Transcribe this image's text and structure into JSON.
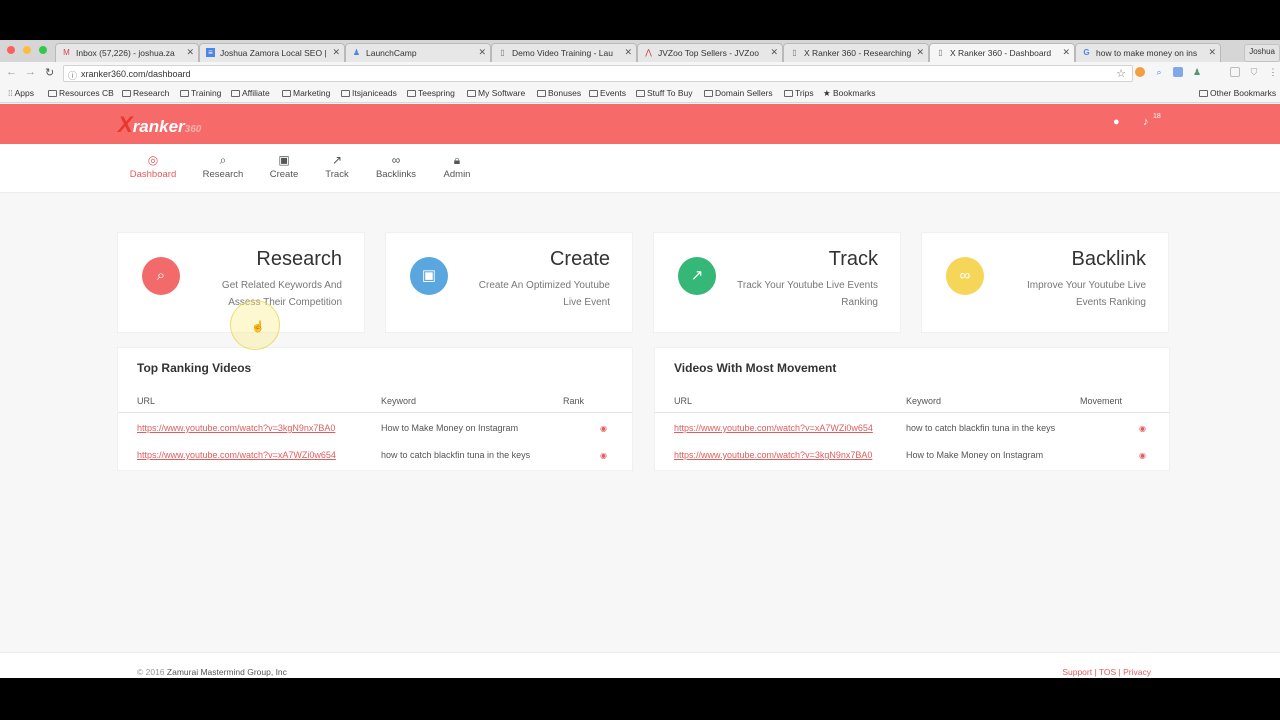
{
  "browser": {
    "tabs": [
      {
        "label": "Inbox (57,226) - joshua.za",
        "icon": "gmail-icon"
      },
      {
        "label": "Joshua Zamora Local SEO |",
        "icon": "doc-icon"
      },
      {
        "label": "LaunchCamp",
        "icon": "person-icon"
      },
      {
        "label": "Demo Video Training - Lau",
        "icon": "page-icon"
      },
      {
        "label": "JVZoo Top Sellers - JVZoo",
        "icon": "jvzoo-icon"
      },
      {
        "label": "X Ranker 360 - Researching",
        "icon": "page-icon"
      },
      {
        "label": "X Ranker 360 - Dashboard",
        "icon": "page-icon"
      },
      {
        "label": "how to make money on ins",
        "icon": "google-icon"
      }
    ],
    "profile": "Joshua",
    "url": "xranker360.com/dashboard",
    "bookmarks": [
      "Apps",
      "Resources CB",
      "Research",
      "Training",
      "Affiliate",
      "Marketing",
      "Itsjaniceads",
      "Teespring",
      "My Software",
      "Bonuses",
      "Events",
      "Stuff To Buy",
      "Domain Sellers",
      "Trips",
      "Bookmarks"
    ],
    "other_bookmarks": "Other Bookmarks"
  },
  "app": {
    "logo": {
      "x": "X",
      "text": "ranker",
      "num": "360"
    },
    "notification_count": "18",
    "accent": "#f76a6a",
    "nav": [
      {
        "label": "Dashboard",
        "icon": "dashboard-gauge-icon"
      },
      {
        "label": "Research",
        "icon": "search-icon"
      },
      {
        "label": "Create",
        "icon": "play-square-icon"
      },
      {
        "label": "Track",
        "icon": "trend-line-icon"
      },
      {
        "label": "Backlinks",
        "icon": "link-icon"
      },
      {
        "label": "Admin",
        "icon": "lock-icon"
      }
    ],
    "cards": [
      {
        "title": "Research",
        "desc": "Get Related Keywords And Assess Their Competition",
        "color": "#f26a6a",
        "icon": "search-icon"
      },
      {
        "title": "Create",
        "desc": "Create An Optimized Youtube Live Event",
        "color": "#5aa6de",
        "icon": "play-square-icon"
      },
      {
        "title": "Track",
        "desc": "Track Your Youtube Live Events Ranking",
        "color": "#34b777",
        "icon": "trend-line-icon"
      },
      {
        "title": "Backlink",
        "desc": "Improve Your Youtube Live Events Ranking",
        "color": "#f5d658",
        "icon": "link-icon"
      }
    ],
    "top_ranking": {
      "title": "Top Ranking Videos",
      "headers": [
        "URL",
        "Keyword",
        "Rank"
      ],
      "rows": [
        {
          "url": "https://www.youtube.com/watch?v=3kgN9nx7BA0",
          "keyword": "How to Make Money on Instagram"
        },
        {
          "url": "https://www.youtube.com/watch?v=xA7WZi0w654",
          "keyword": "how to catch blackfin tuna in the keys"
        }
      ]
    },
    "most_movement": {
      "title": "Videos With Most Movement",
      "headers": [
        "URL",
        "Keyword",
        "Movement"
      ],
      "rows": [
        {
          "url": "https://www.youtube.com/watch?v=xA7WZi0w654",
          "keyword": "how to catch blackfin tuna in the keys"
        },
        {
          "url": "https://www.youtube.com/watch?v=3kgN9nx7BA0",
          "keyword": "How to Make Money on Instagram"
        }
      ]
    },
    "footer": {
      "copy_prefix": "© 2016",
      "company": "Zamurai Mastermind Group, Inc",
      "links": "Support | TOS | Privacy"
    }
  }
}
